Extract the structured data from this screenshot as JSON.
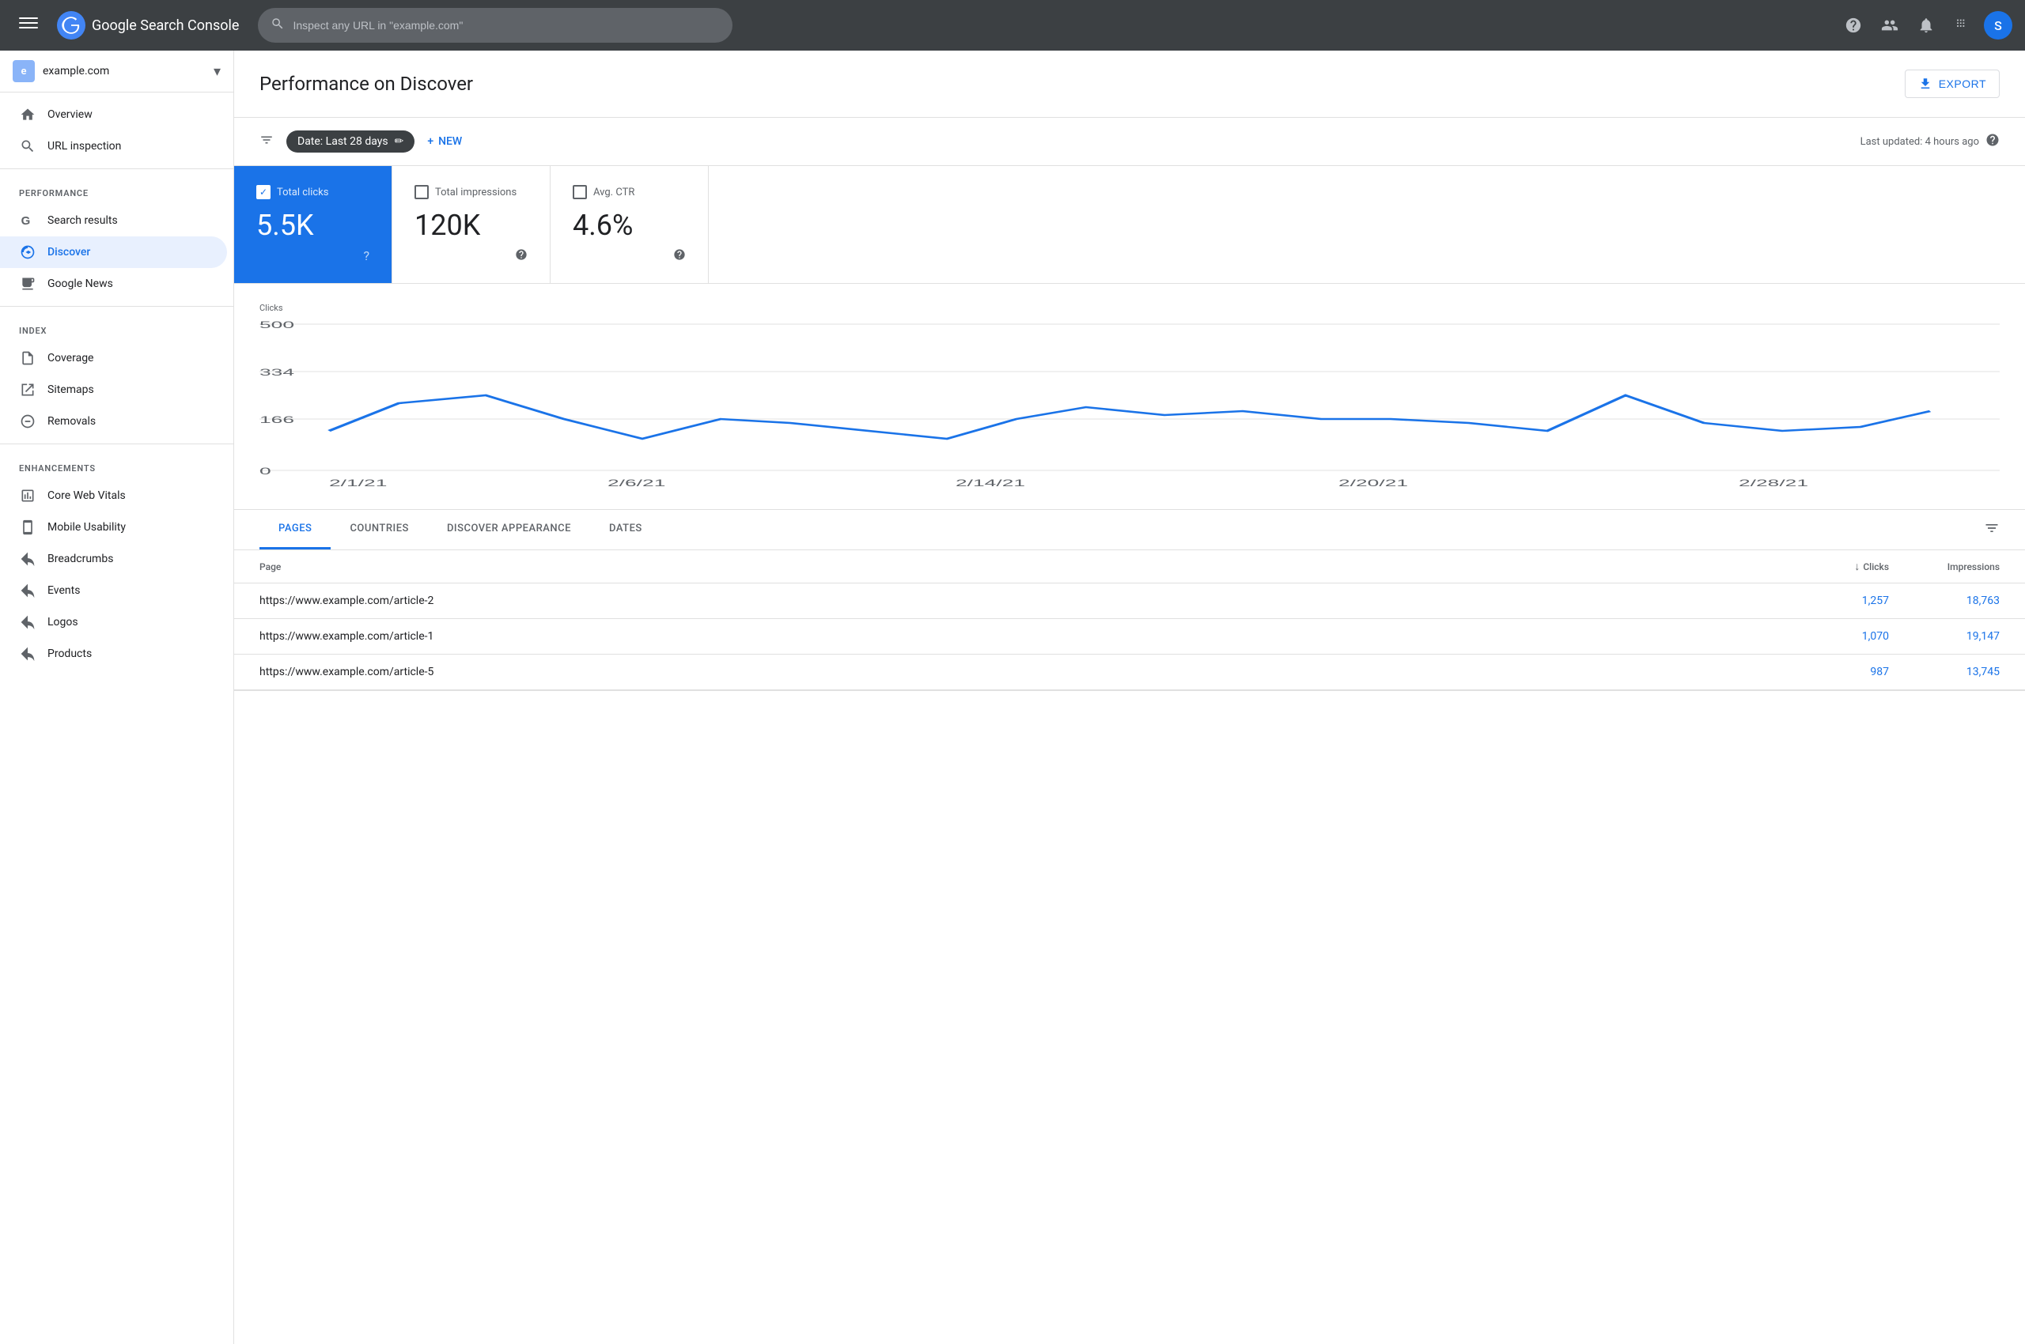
{
  "topnav": {
    "logo_text": "Google Search Console",
    "search_placeholder": "Inspect any URL in \"example.com\"",
    "avatar_letter": "S",
    "last_updated": "Last updated: 4 hours ago"
  },
  "sidebar": {
    "property_name": "example.com",
    "nav_items": [
      {
        "id": "overview",
        "label": "Overview",
        "icon": "home"
      },
      {
        "id": "url-inspection",
        "label": "URL inspection",
        "icon": "search"
      }
    ],
    "sections": [
      {
        "label": "Performance",
        "items": [
          {
            "id": "search-results",
            "label": "Search results",
            "icon": "google"
          },
          {
            "id": "discover",
            "label": "Discover",
            "icon": "asterisk",
            "active": true
          },
          {
            "id": "google-news",
            "label": "Google News",
            "icon": "news"
          }
        ]
      },
      {
        "label": "Index",
        "items": [
          {
            "id": "coverage",
            "label": "Coverage",
            "icon": "file"
          },
          {
            "id": "sitemaps",
            "label": "Sitemaps",
            "icon": "sitemap"
          },
          {
            "id": "removals",
            "label": "Removals",
            "icon": "removals"
          }
        ]
      },
      {
        "label": "Enhancements",
        "items": [
          {
            "id": "core-web-vitals",
            "label": "Core Web Vitals",
            "icon": "vitals"
          },
          {
            "id": "mobile-usability",
            "label": "Mobile Usability",
            "icon": "mobile"
          },
          {
            "id": "breadcrumbs",
            "label": "Breadcrumbs",
            "icon": "breadcrumbs"
          },
          {
            "id": "events",
            "label": "Events",
            "icon": "events"
          },
          {
            "id": "logos",
            "label": "Logos",
            "icon": "logos"
          },
          {
            "id": "products",
            "label": "Products",
            "icon": "products"
          }
        ]
      }
    ]
  },
  "main": {
    "title": "Performance on Discover",
    "export_label": "EXPORT",
    "filter": {
      "date_label": "Date: Last 28 days",
      "new_label": "NEW",
      "last_updated": "Last updated: 4 hours ago"
    },
    "metrics": [
      {
        "id": "total-clicks",
        "label": "Total clicks",
        "value": "5.5K",
        "active": true
      },
      {
        "id": "total-impressions",
        "label": "Total impressions",
        "value": "120K",
        "active": false
      },
      {
        "id": "avg-ctr",
        "label": "Avg. CTR",
        "value": "4.6%",
        "active": false
      }
    ],
    "chart": {
      "y_label": "Clicks",
      "y_ticks": [
        "500",
        "334",
        "166",
        "0"
      ],
      "x_labels": [
        "2/1/21",
        "2/6/21",
        "2/14/21",
        "2/20/21",
        "2/28/21"
      ],
      "line_color": "#1a73e8"
    },
    "tabs": [
      {
        "id": "pages",
        "label": "PAGES",
        "active": true
      },
      {
        "id": "countries",
        "label": "COUNTRIES",
        "active": false
      },
      {
        "id": "discover-appearance",
        "label": "DISCOVER APPEARANCE",
        "active": false
      },
      {
        "id": "dates",
        "label": "DATES",
        "active": false
      }
    ],
    "table": {
      "col_page": "Page",
      "col_clicks": "Clicks",
      "col_impressions": "Impressions",
      "rows": [
        {
          "page": "https://www.example.com/article-2",
          "clicks": "1,257",
          "impressions": "18,763"
        },
        {
          "page": "https://www.example.com/article-1",
          "clicks": "1,070",
          "impressions": "19,147"
        },
        {
          "page": "https://www.example.com/article-5",
          "clicks": "987",
          "impressions": "13,745"
        }
      ]
    }
  }
}
